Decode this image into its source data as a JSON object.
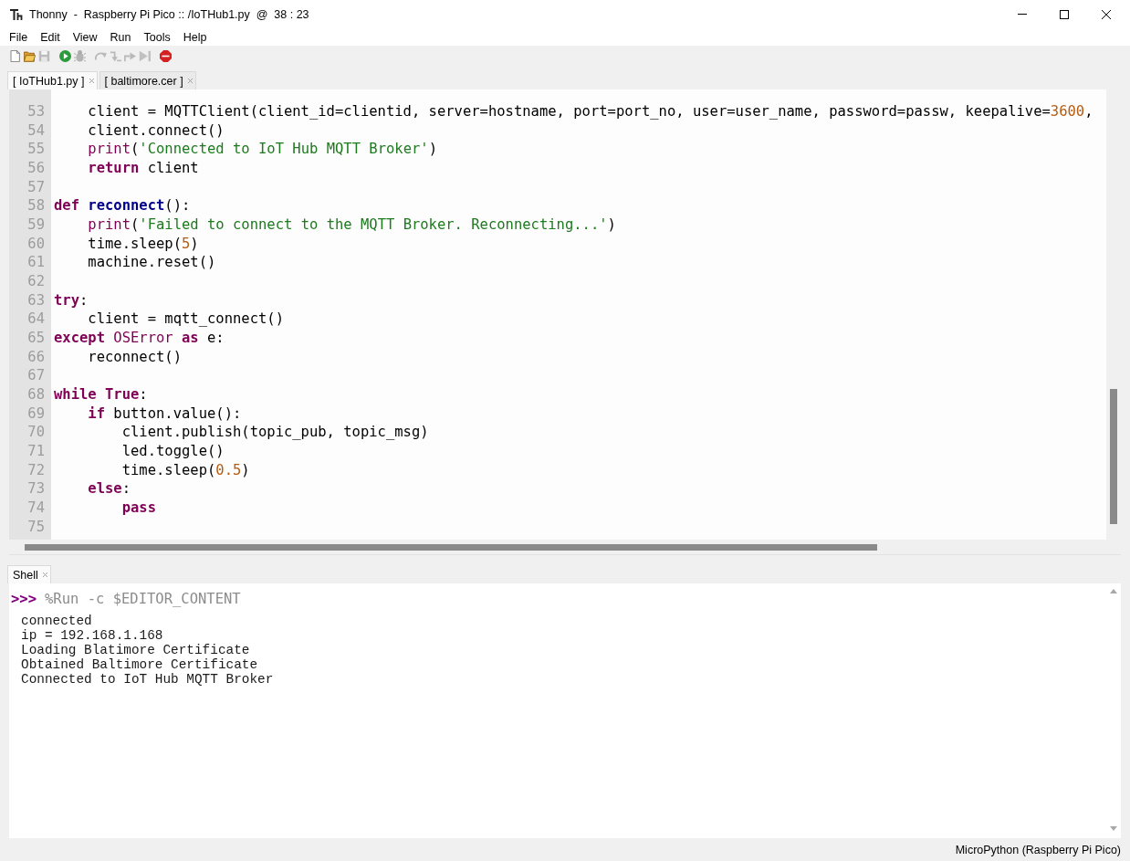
{
  "window": {
    "title": "Thonny  -  Raspberry Pi Pico :: /IoTHub1.py  @  38 : 23"
  },
  "menu": [
    "File",
    "Edit",
    "View",
    "Run",
    "Tools",
    "Help"
  ],
  "toolbar": [
    {
      "kind": "new",
      "disabled": false
    },
    {
      "kind": "open",
      "disabled": false
    },
    {
      "kind": "save",
      "disabled": true
    },
    {
      "kind": "run",
      "disabled": false
    },
    {
      "kind": "debug",
      "disabled": true
    },
    {
      "kind": "step_over",
      "disabled": true
    },
    {
      "kind": "step_into",
      "disabled": true
    },
    {
      "kind": "step_out",
      "disabled": true
    },
    {
      "kind": "resume",
      "disabled": true
    },
    {
      "kind": "stop",
      "disabled": false
    }
  ],
  "editor_tabs": [
    {
      "label": "[ IoTHub1.py ]",
      "selected": true
    },
    {
      "label": "[ baltimore.cer ]",
      "selected": false
    }
  ],
  "editor": {
    "lines": [
      {
        "number": "53",
        "tokens": [
          {
            "text": "    client = MQTTClient(client_id=clientid, server=hostname, port=port_no, user=user_name, password=passw, keepalive=",
            "kind": "plain"
          },
          {
            "text": "3600",
            "kind": "number"
          },
          {
            "text": ",",
            "kind": "plain"
          }
        ]
      },
      {
        "number": "54",
        "tokens": [
          {
            "text": "    client.connect()",
            "kind": "plain"
          }
        ]
      },
      {
        "number": "55",
        "tokens": [
          {
            "text": "    print",
            "kind": "builtin"
          },
          {
            "text": "(",
            "kind": "plain"
          },
          {
            "text": "'Connected to IoT Hub MQTT Broker'",
            "kind": "string"
          },
          {
            "text": ")",
            "kind": "plain"
          }
        ]
      },
      {
        "number": "56",
        "tokens": [
          {
            "text": "    return",
            "kind": "keyword"
          },
          {
            "text": " client",
            "kind": "plain"
          }
        ]
      },
      {
        "number": "57"
      },
      {
        "number": "58",
        "tokens": [
          {
            "text": "def ",
            "kind": "keyword"
          },
          {
            "text": "reconnect",
            "kind": "definition"
          },
          {
            "text": "():",
            "kind": "plain"
          }
        ]
      },
      {
        "number": "59",
        "tokens": [
          {
            "text": "    print",
            "kind": "builtin"
          },
          {
            "text": "(",
            "kind": "plain"
          },
          {
            "text": "'Failed to connect to the MQTT Broker. Reconnecting...'",
            "kind": "string"
          },
          {
            "text": ")",
            "kind": "plain"
          }
        ]
      },
      {
        "number": "60",
        "tokens": [
          {
            "text": "    time.sleep(",
            "kind": "plain"
          },
          {
            "text": "5",
            "kind": "number"
          },
          {
            "text": ")",
            "kind": "plain"
          }
        ]
      },
      {
        "number": "61",
        "tokens": [
          {
            "text": "    machine.reset()",
            "kind": "plain"
          }
        ]
      },
      {
        "number": "62"
      },
      {
        "number": "63",
        "tokens": [
          {
            "text": "try",
            "kind": "keyword"
          },
          {
            "text": ":",
            "kind": "plain"
          }
        ]
      },
      {
        "number": "64",
        "tokens": [
          {
            "text": "    client = mqtt_connect()",
            "kind": "plain"
          }
        ]
      },
      {
        "number": "65",
        "tokens": [
          {
            "text": "except",
            "kind": "keyword"
          },
          {
            "text": " OSError",
            "kind": "builtin"
          },
          {
            "text": " as",
            "kind": "keyword"
          },
          {
            "text": " e:",
            "kind": "plain"
          }
        ]
      },
      {
        "number": "66",
        "tokens": [
          {
            "text": "    reconnect()",
            "kind": "plain"
          }
        ]
      },
      {
        "number": "67"
      },
      {
        "number": "68",
        "tokens": [
          {
            "text": "while True",
            "kind": "keyword"
          },
          {
            "text": ":",
            "kind": "plain"
          }
        ]
      },
      {
        "number": "69",
        "tokens": [
          {
            "text": "    if",
            "kind": "keyword"
          },
          {
            "text": " button.value():",
            "kind": "plain"
          }
        ]
      },
      {
        "number": "70",
        "tokens": [
          {
            "text": "        client.publish(topic_pub, topic_msg)",
            "kind": "plain"
          }
        ]
      },
      {
        "number": "71",
        "tokens": [
          {
            "text": "        led.toggle()",
            "kind": "plain"
          }
        ]
      },
      {
        "number": "72",
        "tokens": [
          {
            "text": "        time.sleep(",
            "kind": "plain"
          },
          {
            "text": "0.5",
            "kind": "number"
          },
          {
            "text": ")",
            "kind": "plain"
          }
        ]
      },
      {
        "number": "73",
        "tokens": [
          {
            "text": "    else",
            "kind": "keyword"
          },
          {
            "text": ":",
            "kind": "plain"
          }
        ]
      },
      {
        "number": "74",
        "tokens": [
          {
            "text": "        pass",
            "kind": "keyword"
          }
        ]
      },
      {
        "number": "75"
      }
    ]
  },
  "shell": {
    "tab": "Shell",
    "prompt": ">>>",
    "command": "%Run -c $EDITOR_CONTENT",
    "output": [
      "connected",
      "ip = 192.168.1.168",
      "Loading Blatimore Certificate",
      "Obtained Baltimore Certificate",
      "Connected to IoT Hub MQTT Broker"
    ]
  },
  "status_bar": {
    "interpreter": "MicroPython (Raspberry Pi Pico)"
  }
}
